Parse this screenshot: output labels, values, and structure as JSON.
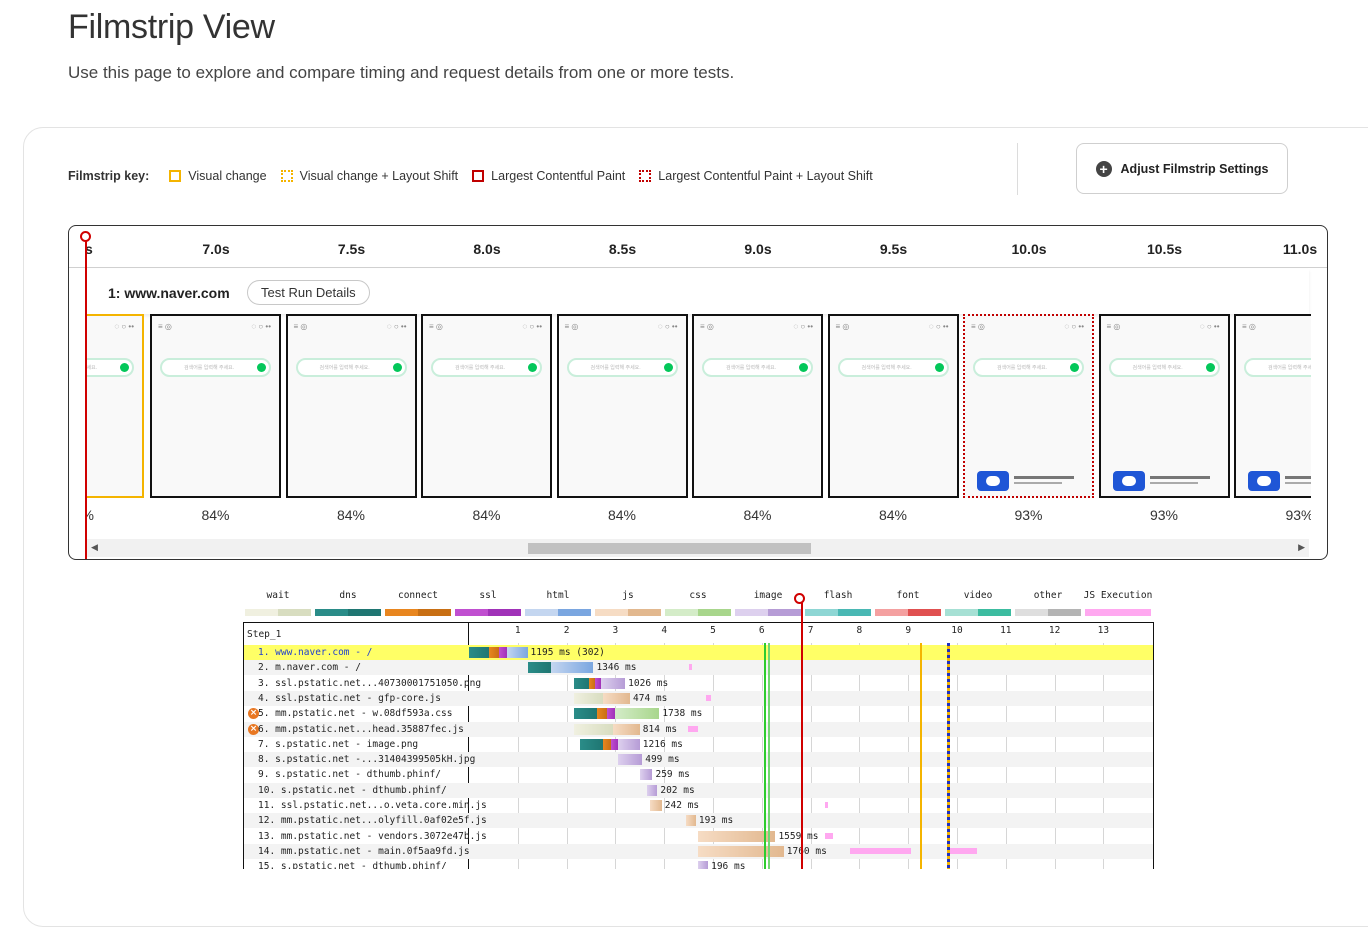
{
  "page": {
    "title": "Filmstrip View",
    "subtitle": "Use this page to explore and compare timing and request details from one or more tests."
  },
  "filmstrip_key": {
    "title": "Filmstrip key:",
    "items": [
      "Visual change",
      "Visual change + Layout Shift",
      "Largest Contentful Paint",
      "Largest Contentful Paint + Layout Shift"
    ]
  },
  "adjust_button": {
    "icon": "plus-icon",
    "label": "Adjust Filmstrip Settings"
  },
  "timeline": {
    "labels": [
      "s",
      "7.0s",
      "7.5s",
      "8.0s",
      "8.5s",
      "9.0s",
      "9.5s",
      "10.0s",
      "10.5s",
      "11.0s"
    ]
  },
  "run": {
    "title": "1: www.naver.com",
    "details_button": "Test Run Details"
  },
  "frames": [
    {
      "pct": "%",
      "style": "visual"
    },
    {
      "pct": "84%",
      "style": "plain"
    },
    {
      "pct": "84%",
      "style": "plain"
    },
    {
      "pct": "84%",
      "style": "plain"
    },
    {
      "pct": "84%",
      "style": "plain"
    },
    {
      "pct": "84%",
      "style": "plain"
    },
    {
      "pct": "84%",
      "style": "plain"
    },
    {
      "pct": "93%",
      "style": "lcp-ls"
    },
    {
      "pct": "93%",
      "style": "plain"
    },
    {
      "pct": "93%",
      "style": "plain"
    }
  ],
  "frame_content": {
    "search_placeholder": "검색어를 입력해 주세요."
  },
  "waterfall": {
    "legend": [
      {
        "label": "wait",
        "colors": [
          "#f0f0e0",
          "#d8ddc0"
        ]
      },
      {
        "label": "dns",
        "colors": [
          "#2a8c88",
          "#1f7672"
        ]
      },
      {
        "label": "connect",
        "colors": [
          "#e8861f",
          "#c86f14"
        ]
      },
      {
        "label": "ssl",
        "colors": [
          "#c04fd0",
          "#a032b8"
        ]
      },
      {
        "label": "html",
        "colors": [
          "#c4d6f0",
          "#7aa6e0"
        ]
      },
      {
        "label": "js",
        "colors": [
          "#f6dcc4",
          "#e2b88f"
        ]
      },
      {
        "label": "css",
        "colors": [
          "#d4ecc8",
          "#a8d68c"
        ]
      },
      {
        "label": "image",
        "colors": [
          "#ddd0ee",
          "#b69cd6"
        ]
      },
      {
        "label": "flash",
        "colors": [
          "#8ed6d4",
          "#4ab8b4"
        ]
      },
      {
        "label": "font",
        "colors": [
          "#f4a0a0",
          "#e05050"
        ]
      },
      {
        "label": "video",
        "colors": [
          "#a6e0d4",
          "#3cbca0"
        ]
      },
      {
        "label": "other",
        "colors": [
          "#dedede",
          "#b4b4b4"
        ]
      },
      {
        "label": "JS Execution",
        "colors": [
          "#ffa8f0",
          "#ffa8f0"
        ]
      }
    ],
    "step_label": "Step_1",
    "ticks": [
      "1",
      "2",
      "3",
      "4",
      "5",
      "6",
      "7",
      "8",
      "9",
      "10",
      "11",
      "12",
      "13"
    ],
    "axis_max_seconds": 13.7,
    "markers": [
      {
        "name": "green-marker",
        "t": 6.05,
        "color": "#2ecc2e"
      },
      {
        "name": "green-marker-2",
        "t": 6.12,
        "color": "#6fd86f"
      },
      {
        "name": "red-marker",
        "t": 6.8,
        "color": "#d00000"
      },
      {
        "name": "orange-marker",
        "t": 9.25,
        "color": "#f4b400"
      },
      {
        "name": "blue-dotted-marker",
        "t": 9.8,
        "color": "#2030c0"
      }
    ],
    "rows": [
      {
        "label": "1. www.naver.com - /",
        "highlight": true,
        "error": false,
        "ms": "1195 ms (302)",
        "segs": [
          {
            "s": 0.0,
            "e": 0.42,
            "t": "dns"
          },
          {
            "s": 0.42,
            "e": 0.62,
            "t": "connect"
          },
          {
            "s": 0.62,
            "e": 0.78,
            "t": "ssl"
          },
          {
            "s": 0.78,
            "e": 1.2,
            "t": "html"
          }
        ],
        "js": []
      },
      {
        "label": "2. m.naver.com - /",
        "highlight": false,
        "error": false,
        "ms": "1346 ms",
        "segs": [
          {
            "s": 1.2,
            "e": 1.68,
            "t": "dns"
          },
          {
            "s": 1.68,
            "e": 2.55,
            "t": "html"
          }
        ],
        "js": [
          {
            "s": 4.5,
            "e": 4.56
          }
        ]
      },
      {
        "label": "3. ssl.pstatic.net...40730001751050.png",
        "highlight": false,
        "error": false,
        "ms": "1026 ms",
        "segs": [
          {
            "s": 2.15,
            "e": 2.45,
            "t": "dns"
          },
          {
            "s": 2.45,
            "e": 2.58,
            "t": "connect"
          },
          {
            "s": 2.58,
            "e": 2.7,
            "t": "ssl"
          },
          {
            "s": 2.7,
            "e": 3.2,
            "t": "image"
          }
        ],
        "js": []
      },
      {
        "label": "4. ssl.pstatic.net - gfp-core.js",
        "highlight": false,
        "error": false,
        "ms": "474 ms",
        "segs": [
          {
            "s": 2.15,
            "e": 2.75,
            "t": "wait"
          },
          {
            "s": 2.75,
            "e": 3.3,
            "t": "js"
          }
        ],
        "js": [
          {
            "s": 4.85,
            "e": 4.95
          }
        ]
      },
      {
        "label": "5. mm.pstatic.net - w.08df593a.css",
        "highlight": false,
        "error": true,
        "ms": "1738 ms",
        "segs": [
          {
            "s": 2.15,
            "e": 2.62,
            "t": "dns"
          },
          {
            "s": 2.62,
            "e": 2.82,
            "t": "connect"
          },
          {
            "s": 2.82,
            "e": 3.0,
            "t": "ssl"
          },
          {
            "s": 3.0,
            "e": 3.9,
            "t": "css"
          }
        ],
        "js": []
      },
      {
        "label": "6. mm.pstatic.net...head.35887fec.js",
        "highlight": false,
        "error": true,
        "ms": "814 ms",
        "segs": [
          {
            "s": 2.15,
            "e": 2.95,
            "t": "wait"
          },
          {
            "s": 2.95,
            "e": 3.5,
            "t": "js"
          }
        ],
        "js": [
          {
            "s": 4.48,
            "e": 4.7
          }
        ]
      },
      {
        "label": "7. s.pstatic.net - image.png",
        "highlight": false,
        "error": false,
        "ms": "1216 ms",
        "segs": [
          {
            "s": 2.28,
            "e": 2.75,
            "t": "dns"
          },
          {
            "s": 2.75,
            "e": 2.9,
            "t": "connect"
          },
          {
            "s": 2.9,
            "e": 3.05,
            "t": "ssl"
          },
          {
            "s": 3.05,
            "e": 3.5,
            "t": "image"
          }
        ],
        "js": []
      },
      {
        "label": "8. s.pstatic.net -...31404399505kH.jpg",
        "highlight": false,
        "error": false,
        "ms": "499 ms",
        "segs": [
          {
            "s": 3.05,
            "e": 3.55,
            "t": "image"
          }
        ],
        "js": []
      },
      {
        "label": "9. s.pstatic.net - dthumb.phinf/",
        "highlight": false,
        "error": false,
        "ms": "259 ms",
        "segs": [
          {
            "s": 3.5,
            "e": 3.76,
            "t": "image"
          }
        ],
        "js": []
      },
      {
        "label": "10. s.pstatic.net - dthumb.phinf/",
        "highlight": false,
        "error": false,
        "ms": "202 ms",
        "segs": [
          {
            "s": 3.65,
            "e": 3.86,
            "t": "image"
          }
        ],
        "js": []
      },
      {
        "label": "11. ssl.pstatic.net...o.veta.core.min.js",
        "highlight": false,
        "error": false,
        "ms": "242 ms",
        "segs": [
          {
            "s": 3.7,
            "e": 3.95,
            "t": "js"
          }
        ],
        "js": [
          {
            "s": 7.3,
            "e": 7.35
          }
        ]
      },
      {
        "label": "12. mm.pstatic.net...olyfill.0af02e5f.js",
        "highlight": false,
        "error": false,
        "ms": "193 ms",
        "segs": [
          {
            "s": 4.45,
            "e": 4.65,
            "t": "js"
          }
        ],
        "js": []
      },
      {
        "label": "13. mm.pstatic.net - vendors.3072e47b.js",
        "highlight": false,
        "error": false,
        "ms": "1559 ms",
        "segs": [
          {
            "s": 4.7,
            "e": 6.28,
            "t": "js"
          }
        ],
        "js": [
          {
            "s": 7.3,
            "e": 7.45
          }
        ]
      },
      {
        "label": "14. mm.pstatic.net - main.0f5aa9fd.js",
        "highlight": false,
        "error": false,
        "ms": "1760 ms",
        "segs": [
          {
            "s": 4.7,
            "e": 6.45,
            "t": "js"
          }
        ],
        "js": [
          {
            "s": 7.8,
            "e": 9.05
          },
          {
            "s": 9.8,
            "e": 10.4
          }
        ]
      },
      {
        "label": "15. s.pstatic.net - dthumb.phinf/",
        "highlight": false,
        "error": false,
        "ms": "196 ms",
        "segs": [
          {
            "s": 4.7,
            "e": 4.9,
            "t": "image"
          }
        ],
        "js": []
      }
    ]
  }
}
